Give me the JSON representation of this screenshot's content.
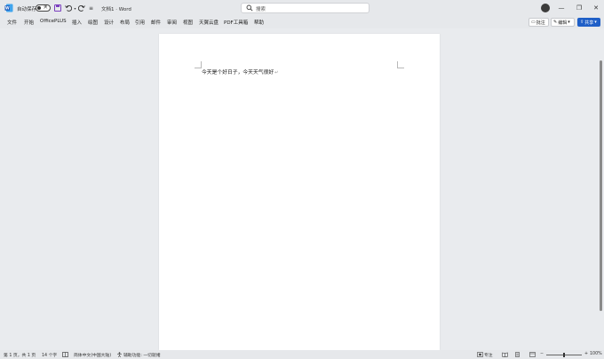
{
  "titlebar": {
    "autosave_label": "自动保存",
    "autosave_toggle": "关",
    "doc_title": "文档1 · Word",
    "search_placeholder": "搜索",
    "minimize": "—",
    "restore": "❐",
    "close": "✕"
  },
  "ribbon": {
    "tabs": [
      "文件",
      "开始",
      "OfficePLUS",
      "插入",
      "绘图",
      "设计",
      "布局",
      "引用",
      "邮件",
      "审阅",
      "视图",
      "天翼云盘",
      "PDF工具箱",
      "帮助"
    ],
    "comments_label": "批注",
    "editing_label": "编辑",
    "share_label": "共享"
  },
  "document": {
    "text": "今天是个好日子，今天天气很好",
    "paragraph_mark": "↵"
  },
  "statusbar": {
    "page_info": "第 1 页，共 1 页",
    "word_count": "14 个字",
    "language": "简体中文(中国大陆)",
    "accessibility": "辅助功能: 一切就绪",
    "focus_label": "专注",
    "zoom_minus": "−",
    "zoom_plus": "+",
    "zoom_level": "100%",
    "zoom_fraction": 0.5
  },
  "colors": {
    "word_blue": "#185abd",
    "share_blue": "#1f5fc7",
    "chrome_bg": "#e6e8eb",
    "canvas_bg": "#e9ebee"
  }
}
